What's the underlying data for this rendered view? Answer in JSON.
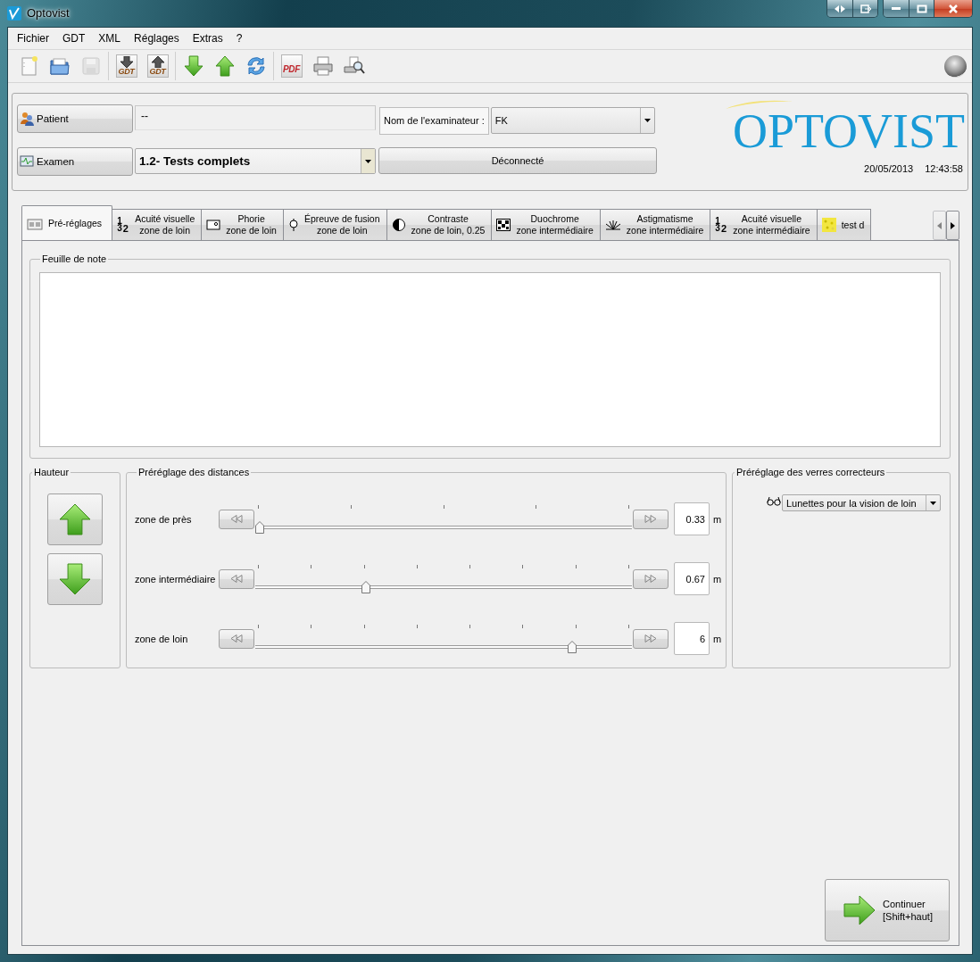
{
  "window": {
    "title": "Optovist"
  },
  "menu": [
    "Fichier",
    "GDT",
    "XML",
    "Réglages",
    "Extras",
    "?"
  ],
  "toolbar": {
    "items": [
      {
        "kind": "new",
        "disabled": false
      },
      {
        "kind": "open",
        "disabled": false
      },
      {
        "kind": "save",
        "disabled": true
      },
      {
        "kind": "separator"
      },
      {
        "kind": "gdt-import",
        "label": "GDT",
        "disabled": false
      },
      {
        "kind": "gdt-export",
        "label": "GDT",
        "disabled": false
      },
      {
        "kind": "separator"
      },
      {
        "kind": "download",
        "disabled": false
      },
      {
        "kind": "upload",
        "disabled": false
      },
      {
        "kind": "refresh",
        "disabled": false
      },
      {
        "kind": "separator"
      },
      {
        "kind": "pdf",
        "label": "PDF",
        "disabled": false
      },
      {
        "kind": "print",
        "disabled": false
      },
      {
        "kind": "preview",
        "disabled": false
      }
    ],
    "status_light": {
      "on": false
    }
  },
  "header": {
    "patient_button": "Patient",
    "patient_value": "--",
    "examiner_label": "Nom de l'examinateur :",
    "examiner_value": "FK",
    "exam_button": "Examen",
    "exam_value": "1.2- Tests complets",
    "connection_button": "Déconnecté",
    "logo": "OPTOVIST",
    "date": "20/05/2013",
    "time": "12:43:58"
  },
  "tabs": {
    "items": [
      {
        "kind": "presets",
        "title": "Pré-réglages",
        "selected": true
      },
      {
        "kind": "digits",
        "icon_text": "132",
        "title": "Acuité visuelle",
        "subtitle": "zone de loin",
        "selected": false
      },
      {
        "kind": "phoria",
        "title": "Phorie",
        "subtitle": "zone de loin",
        "selected": false
      },
      {
        "kind": "fusion",
        "title": "Épreuve de fusion",
        "subtitle": "zone de loin",
        "selected": false
      },
      {
        "kind": "contrast",
        "title": "Contraste",
        "subtitle": "zone de loin, 0.25",
        "selected": false
      },
      {
        "kind": "duochrome",
        "title": "Duochrome",
        "subtitle": "zone intermédiaire",
        "selected": false
      },
      {
        "kind": "astigmatism",
        "title": "Astigmatisme",
        "subtitle": "zone intermédiaire",
        "selected": false
      },
      {
        "kind": "digits",
        "icon_text": "132",
        "title": "Acuité visuelle",
        "subtitle": "zone intermédiaire",
        "selected": false
      },
      {
        "kind": "noise",
        "title": "test d",
        "selected": false
      }
    ],
    "scroll_left": {
      "disabled": true
    },
    "scroll_right": {
      "disabled": false
    }
  },
  "notes": {
    "title": "Feuille de note"
  },
  "height": {
    "title": "Hauteur"
  },
  "distances": {
    "title": "Préréglage des distances",
    "rows": [
      {
        "label": "zone de près",
        "kind": "coarse",
        "level": 0,
        "value": "0.33",
        "unit": "m"
      },
      {
        "label": "zone intermédiaire",
        "kind": "fine",
        "level": 0.29,
        "value": "0.67",
        "unit": "m"
      },
      {
        "label": "zone de loin",
        "kind": "fine",
        "level": 0.85,
        "value": "6",
        "unit": "m"
      }
    ]
  },
  "lenses": {
    "title": "Préréglage des verres correcteurs",
    "value": "Lunettes pour la vision de loin"
  },
  "continue_button": {
    "label": "Continuer\n[Shift+haut]"
  }
}
